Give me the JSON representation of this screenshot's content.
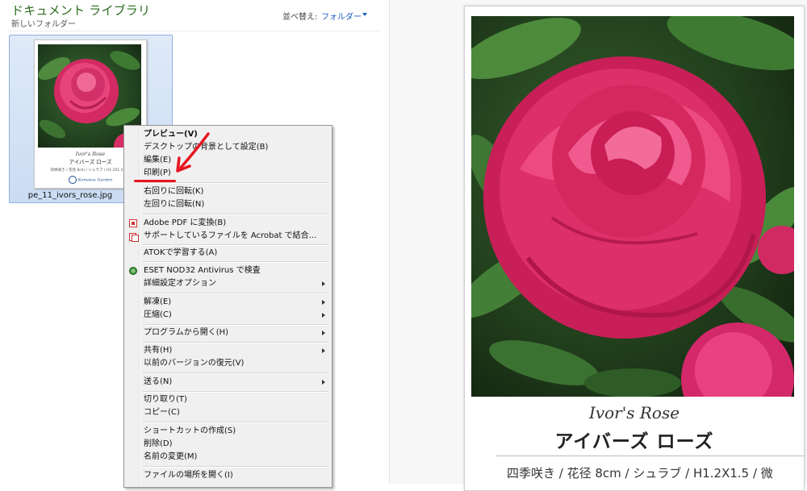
{
  "explorer": {
    "library_title": "ドキュメント ライブラリ",
    "new_folder": "新しいフォルダー",
    "sort_label": "並べ替え:",
    "sort_value": "フォルダー",
    "file": {
      "name": "pe_11_ivors_rose.jpg",
      "thumb_title_en": "Ivor's Rose",
      "thumb_title_ja": "アイバーズ ローズ",
      "thumb_spec": "四季咲き / 花径 8cm / シュラブ / H1.2X1.5 / 強",
      "thumb_logo": "Komatsu Garden"
    }
  },
  "context_menu": {
    "items": [
      {
        "label": "プレビュー(V)"
      },
      {
        "label": "デスクトップの背景として設定(B)"
      },
      {
        "label": "編集(E)"
      },
      {
        "label": "印刷(P)"
      },
      {
        "label": "右回りに回転(K)"
      },
      {
        "label": "左回りに回転(N)"
      },
      {
        "label": "Adobe PDF に変換(B)",
        "icon": "adobe-pdf-icon"
      },
      {
        "label": "サポートしているファイルを Acrobat で結合...",
        "icon": "acrobat-combine-icon"
      },
      {
        "label": "ATOKで学習する(A)"
      },
      {
        "label": "ESET NOD32 Antivirus で検査",
        "icon": "eset-icon"
      },
      {
        "label": "詳細設定オプション"
      },
      {
        "label": "解凍(E)"
      },
      {
        "label": "圧縮(C)"
      },
      {
        "label": "プログラムから開く(H)"
      },
      {
        "label": "共有(H)"
      },
      {
        "label": "以前のバージョンの復元(V)"
      },
      {
        "label": "送る(N)"
      },
      {
        "label": "切り取り(T)"
      },
      {
        "label": "コピー(C)"
      },
      {
        "label": "ショートカットの作成(S)"
      },
      {
        "label": "削除(D)"
      },
      {
        "label": "名前の変更(M)"
      },
      {
        "label": "ファイルの場所を開く(I)"
      }
    ]
  },
  "preview": {
    "title_en": "Ivor's Rose",
    "title_ja": "アイバーズ ローズ",
    "spec": "四季咲き / 花径 8cm / シュラブ / H1.2X1.5 / 微"
  },
  "colors": {
    "annotation_red": "#e8151f",
    "selection_blue": "#cbdcf3",
    "rose_pink": "#e0336e"
  }
}
